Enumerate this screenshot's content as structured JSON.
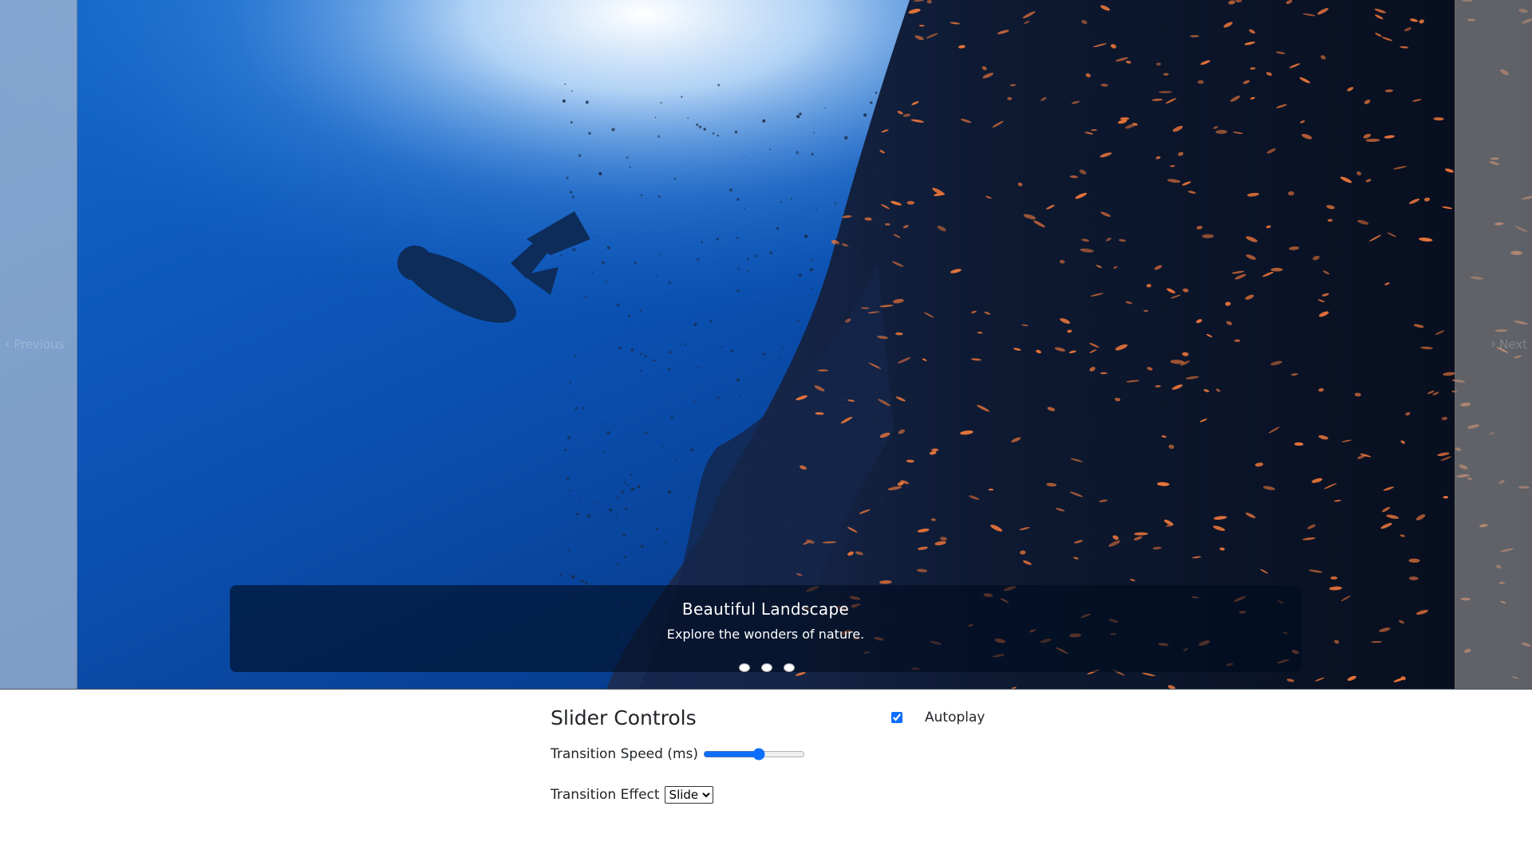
{
  "slider": {
    "prev_label": "Previous",
    "next_label": "Next",
    "caption": {
      "title": "Beautiful Landscape",
      "subtitle": "Explore the wonders of nature."
    },
    "slide_count": 3,
    "active_slide": 1
  },
  "controls": {
    "title": "Slider Controls",
    "autoplay_label": "Autoplay",
    "autoplay_checked": true,
    "speed_label": "Transition Speed (ms)",
    "speed_fraction": 0.55,
    "effect_label": "Transition Effect",
    "effect_selected": "Slide"
  },
  "colors": {
    "accent": "#0d6efd"
  }
}
